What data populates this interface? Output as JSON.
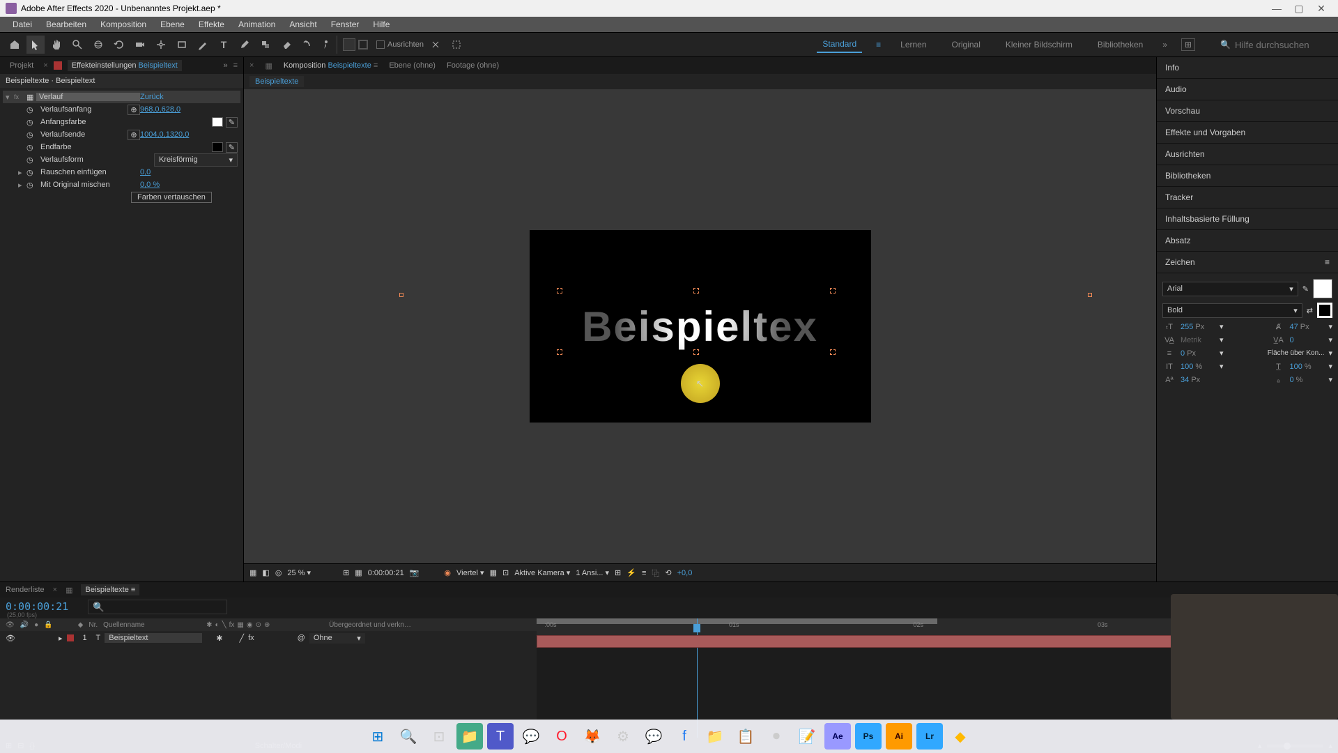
{
  "titlebar": {
    "title": "Adobe After Effects 2020 - Unbenanntes Projekt.aep *"
  },
  "menubar": [
    "Datei",
    "Bearbeiten",
    "Komposition",
    "Ebene",
    "Effekte",
    "Animation",
    "Ansicht",
    "Fenster",
    "Hilfe"
  ],
  "toolbar": {
    "ausrichten": "Ausrichten"
  },
  "workspaces": {
    "items": [
      "Standard",
      "Lernen",
      "Original",
      "Kleiner Bildschirm",
      "Bibliotheken"
    ],
    "active": "Standard"
  },
  "search": {
    "placeholder": "Hilfe durchsuchen"
  },
  "leftpanel": {
    "tab_projekt": "Projekt",
    "tab_effekt_prefix": "Effekteinstellungen",
    "tab_effekt_link": "Beispieltext",
    "breadcrumb": "Beispieltexte · Beispieltext",
    "effect_name": "Verlauf",
    "reset": "Zurück",
    "params": {
      "verlaufsanfang": {
        "label": "Verlaufsanfang",
        "val": "968,0,628,0"
      },
      "anfangsfarbe": {
        "label": "Anfangsfarbe"
      },
      "verlaufsende": {
        "label": "Verlaufsende",
        "val": "1004,0,1320,0"
      },
      "endfarbe": {
        "label": "Endfarbe"
      },
      "verlaufsform": {
        "label": "Verlaufsform",
        "val": "Kreisförmig"
      },
      "rauschen": {
        "label": "Rauschen einfügen",
        "val": "0,0"
      },
      "original": {
        "label": "Mit Original mischen",
        "val": "0,0 %"
      },
      "swap": "Farben vertauschen"
    }
  },
  "center": {
    "tab_komp_prefix": "Komposition",
    "tab_komp_link": "Beispieltexte",
    "tab_ebene": "Ebene  (ohne)",
    "tab_footage": "Footage  (ohne)",
    "subtab": "Beispieltexte",
    "preview_text": "Beispieltex",
    "footer": {
      "zoom": "25 %",
      "time": "0:00:00:21",
      "res": "Viertel",
      "camera": "Aktive Kamera",
      "views": "1 Ansi...",
      "exposure": "+0,0"
    }
  },
  "rightpanel": {
    "groups": [
      "Info",
      "Audio",
      "Vorschau",
      "Effekte und Vorgaben",
      "Ausrichten",
      "Bibliotheken",
      "Tracker",
      "Inhaltsbasierte Füllung",
      "Absatz"
    ],
    "zeichen": {
      "title": "Zeichen",
      "font": "Arial",
      "weight": "Bold",
      "size": "255",
      "leading": "47",
      "kerning": "Metrik",
      "tracking": "0",
      "stroke": "0",
      "strokeOpt": "Fläche über Kon...",
      "hscale": "100",
      "vscale": "100",
      "baseline": "34",
      "tsume": "0"
    }
  },
  "timeline": {
    "tab_render": "Renderliste",
    "tab_comp": "Beispieltexte",
    "timecode": "0:00:00:21",
    "fps": "(25,00 fps)",
    "col_nr": "Nr.",
    "col_source": "Quellenname",
    "col_parent": "Übergeordnet und verkn…",
    "layer_num": "1",
    "layer_name": "Beispieltext",
    "parent_val": "Ohne",
    "ticks": [
      ":00s",
      "01s",
      "02s",
      "03s"
    ],
    "footer_label": "Schalter/Modi"
  }
}
